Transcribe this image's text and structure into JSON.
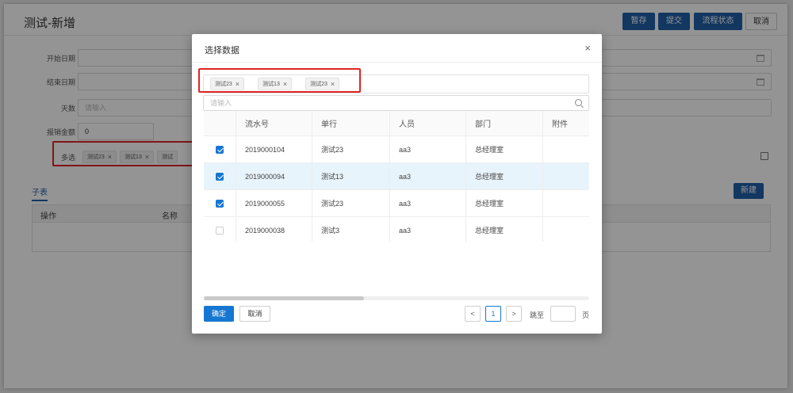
{
  "page": {
    "title": "测试-新增",
    "buttons": [
      "暂存",
      "提交",
      "流程状态",
      "取消"
    ],
    "form": {
      "start_label": "开始日期",
      "end_label": "结束日期",
      "days_label": "天数",
      "days_placeholder": "请输入",
      "amount_label": "报销金额",
      "amount_value": "0",
      "multi_label": "多选",
      "multi_tags": [
        "测试23",
        "测试13",
        "测试"
      ]
    },
    "sub": {
      "tab": "子表",
      "new_button": "新建",
      "columns": [
        "操作",
        "名称"
      ]
    }
  },
  "modal": {
    "title": "选择数据",
    "close_glyph": "×",
    "selected_tags": [
      "测试23",
      "测试13",
      "测试23"
    ],
    "search_placeholder": "请输入",
    "columns": [
      "流水号",
      "单行",
      "人员",
      "部门",
      "附件"
    ],
    "rows": [
      {
        "checked": true,
        "serial": "2019000104",
        "single": "测试23",
        "person": "aa3",
        "dept": "总经理室",
        "attach": ""
      },
      {
        "checked": true,
        "serial": "2019000094",
        "single": "测试13",
        "person": "aa3",
        "dept": "总经理室",
        "attach": ""
      },
      {
        "checked": true,
        "serial": "2019000055",
        "single": "测试23",
        "person": "aa3",
        "dept": "总经理室",
        "attach": ""
      },
      {
        "checked": false,
        "serial": "2019000038",
        "single": "测试3",
        "person": "aa3",
        "dept": "总经理室",
        "attach": ""
      }
    ],
    "ok_button": "确定",
    "cancel_button": "取消",
    "pagination": {
      "prev": "<",
      "current": "1",
      "next": ">",
      "goto_label": "跳至",
      "page_suffix": "页"
    }
  },
  "colors": {
    "primary": "#1677d2",
    "header_button": "#1f5fa8",
    "highlight": "#e02424",
    "selected_row": "#e8f4fb"
  }
}
